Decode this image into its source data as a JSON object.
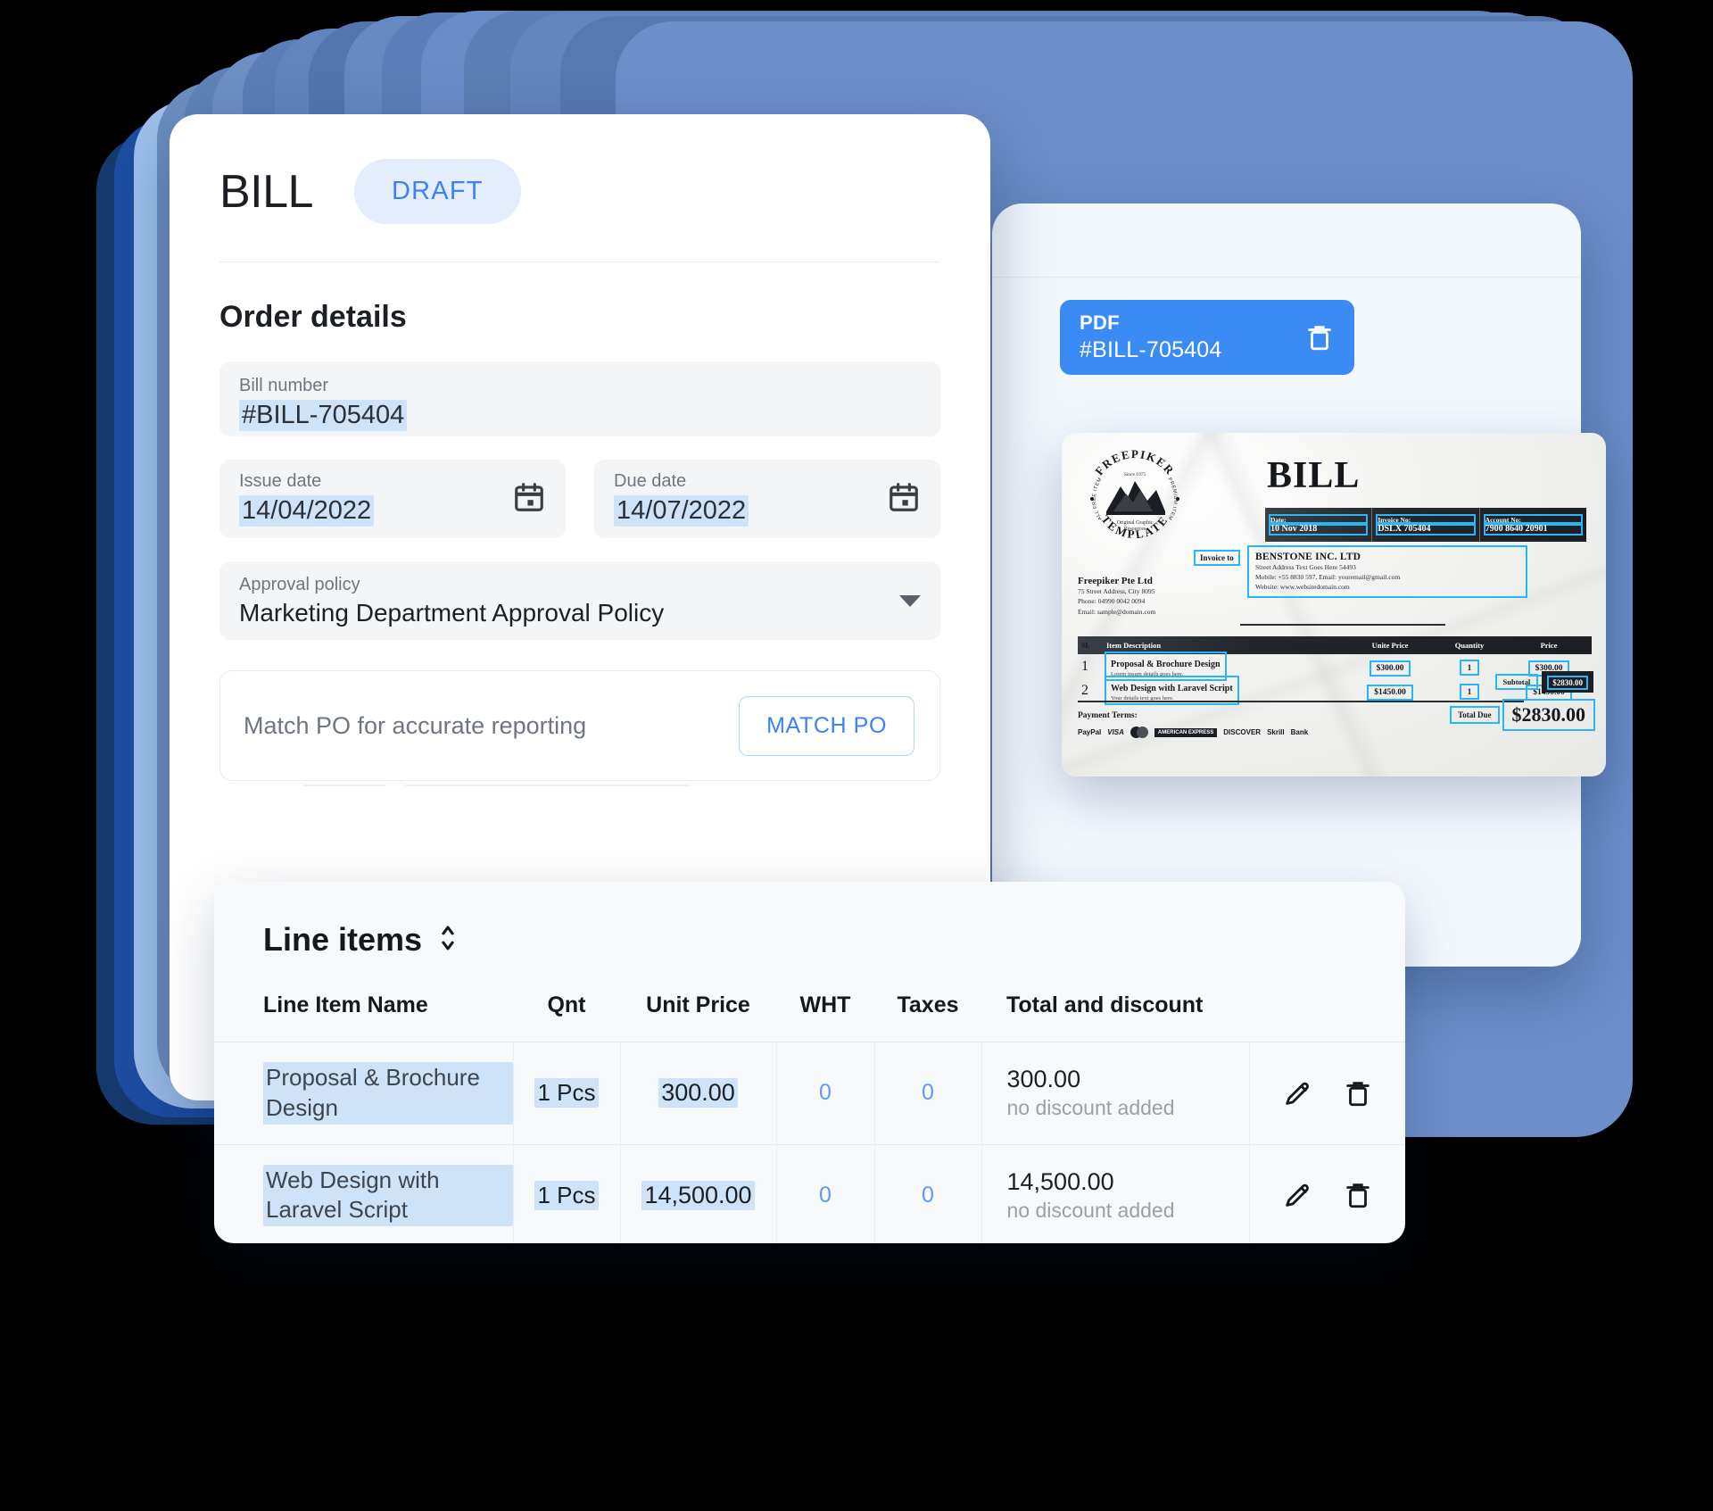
{
  "bill": {
    "title": "BILL",
    "status": "DRAFT",
    "section_title": "Order details",
    "fields": {
      "bill_number": {
        "label": "Bill number",
        "value": "#BILL-705404"
      },
      "issue_date": {
        "label": "Issue date",
        "value": "14/04/2022"
      },
      "due_date": {
        "label": "Due date",
        "value": "14/07/2022"
      },
      "approval_policy": {
        "label": "Approval policy",
        "value": "Marketing Department Approval Policy"
      }
    },
    "match_po": {
      "text": "Match PO for accurate reporting",
      "button": "MATCH PO"
    }
  },
  "line_items": {
    "title": "Line items",
    "columns": [
      "Line Item Name",
      "Qnt",
      "Unit Price",
      "WHT",
      "Taxes",
      "Total and discount"
    ],
    "rows": [
      {
        "name": "Proposal & Brochure Design",
        "qnt": "1 Pcs",
        "unit_price": "300.00",
        "wht": "0",
        "taxes": "0",
        "total": "300.00",
        "discount": "no discount added"
      },
      {
        "name": "Web Design with Laravel Script",
        "qnt": "1 Pcs",
        "unit_price": "14,500.00",
        "wht": "0",
        "taxes": "0",
        "total": "14,500.00",
        "discount": "no discount added"
      }
    ]
  },
  "pdf_panel": {
    "chip_type": "PDF",
    "chip_name": "#BILL-705404"
  },
  "scan": {
    "title": "BILL",
    "logo": {
      "top_text": "FREEPIKER",
      "bottom_text": "TEMPLATE",
      "since": "Since 1975",
      "tagline": "Original Graphic Resources",
      "left_arc": "ALL FREE ITEM",
      "right_arc": "PREMIUM ITEM"
    },
    "meta": [
      {
        "label": "Date:",
        "value": "10 Nov 2018"
      },
      {
        "label": "Invoice No:",
        "value": "DSLX 705404"
      },
      {
        "label": "Account No:",
        "value": "7900 8640 20901"
      }
    ],
    "invoice_to_tag": "Invoice to",
    "bill_to": {
      "name": "BENSTONE INC. LTD",
      "lines": [
        "Street Address Text Goes Here 54493",
        "Mobile: +55 8830 597, Email: youremail@gmail.com",
        "Website: www.websitedomain.com"
      ]
    },
    "from": {
      "name": "Freepiker Pte Ltd",
      "lines": [
        "75 Street Address, City 8095",
        "Phone: 04990 0042 0094",
        "Email: sample@domain.com"
      ]
    },
    "table": {
      "headers": [
        "Sl.",
        "Item Description",
        "Unite Price",
        "Quantity",
        "Price"
      ],
      "rows": [
        {
          "sl": "1",
          "desc": "Proposal & Brochure Design",
          "sub": "Lorem ipsum details goes here.",
          "unit": "$300.00",
          "qty": "1",
          "price": "$300.00"
        },
        {
          "sl": "2",
          "desc": "Web Design with Laravel Script",
          "sub": "Your details text goes here.",
          "unit": "$1450.00",
          "qty": "1",
          "price": "$1450.00"
        }
      ]
    },
    "payment_terms_label": "Payment Terms:",
    "payment_methods": [
      "PayPal",
      "VISA",
      "Mastercard",
      "AMERICAN EXPRESS",
      "DISCOVER",
      "Skrill",
      "Bank"
    ],
    "subtotal_label": "Subtotal",
    "subtotal_value": "$2830.00",
    "total_due_label": "Total Due",
    "total_due_value": "$2830.00"
  },
  "colors": {
    "accent_blue": "#3b82f6",
    "chip_blue": "#3b8bf5",
    "highlight": "#cfe3f8",
    "scan_highlight": "#29b6f6",
    "background": "#000000"
  }
}
